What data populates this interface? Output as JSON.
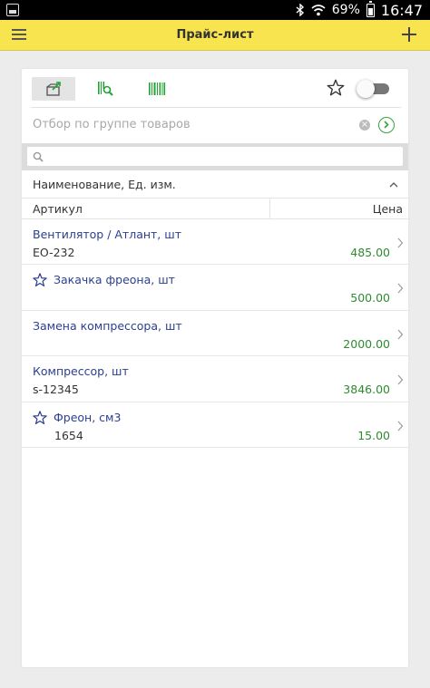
{
  "status_bar": {
    "battery": "69%",
    "time": "16:47"
  },
  "app_bar": {
    "title": "Прайс-лист"
  },
  "filter": {
    "placeholder": "Отбор по группе товаров",
    "clear_symbol": "×"
  },
  "search": {
    "value": ""
  },
  "group_header": "Наименование, Ед. изм.",
  "columns": {
    "article": "Артикул",
    "price": "Цена"
  },
  "items": [
    {
      "name": "Вентилятор / Атлант, шт",
      "code": "EO-232",
      "price": "485.00",
      "favorite": false
    },
    {
      "name": "Закачка фреона, шт",
      "code": "",
      "price": "500.00",
      "favorite": true
    },
    {
      "name": "Замена компрессора, шт",
      "code": "",
      "price": "2000.00",
      "favorite": false
    },
    {
      "name": "Компрессор, шт",
      "code": "s-12345",
      "price": "3846.00",
      "favorite": false
    },
    {
      "name": "Фреон, см3",
      "code": "1654",
      "price": "15.00",
      "favorite": true
    }
  ],
  "colors": {
    "accent_yellow": "#f8e44f",
    "link_blue": "#2b3f8f",
    "price_green": "#2e8b2e",
    "icon_green": "#23a336"
  },
  "icons": [
    "menu-icon",
    "add-icon",
    "folder-icon",
    "search-scanner-icon",
    "barcode-icon",
    "star-icon",
    "chevron-right-icon"
  ]
}
